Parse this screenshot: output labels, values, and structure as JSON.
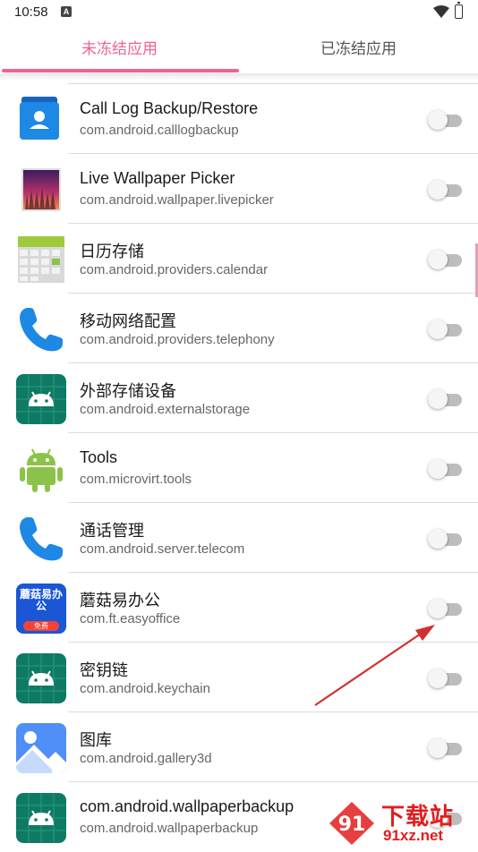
{
  "status_bar": {
    "time": "10:58",
    "notification_glyph": "A"
  },
  "tabs": [
    {
      "label": "未冻结应用",
      "active": true
    },
    {
      "label": "已冻结应用",
      "active": false
    }
  ],
  "colors": {
    "accent": "#f06292",
    "toggle_off": "#bdbdbd",
    "arrow": "#d32f2f"
  },
  "apps": [
    {
      "title": "Call Log Backup/Restore",
      "package": "com.android.calllogbackup",
      "icon": "contacts-backup-icon",
      "enabled": false
    },
    {
      "title": "Live Wallpaper Picker",
      "package": "com.android.wallpaper.livepicker",
      "icon": "wallpaper-picker-icon",
      "enabled": false
    },
    {
      "title": "日历存储",
      "package": "com.android.providers.calendar",
      "icon": "calendar-storage-icon",
      "enabled": false
    },
    {
      "title": "移动网络配置",
      "package": "com.android.providers.telephony",
      "icon": "phone-icon",
      "enabled": false
    },
    {
      "title": "外部存储设备",
      "package": "com.android.externalstorage",
      "icon": "android-icon",
      "enabled": false
    },
    {
      "title": "Tools",
      "package": "com.microvirt.tools",
      "icon": "android-green-icon",
      "enabled": false
    },
    {
      "title": "通话管理",
      "package": "com.android.server.telecom",
      "icon": "phone-icon",
      "enabled": false
    },
    {
      "title": "蘑菇易办公",
      "package": "com.ft.easyoffice",
      "icon": "easyoffice-icon",
      "enabled": false,
      "icon_text": "蘑菇易办公",
      "icon_badge": "免费"
    },
    {
      "title": "密钥链",
      "package": "com.android.keychain",
      "icon": "android-icon",
      "enabled": false
    },
    {
      "title": "图库",
      "package": "com.android.gallery3d",
      "icon": "gallery-icon",
      "enabled": false
    },
    {
      "title": "com.android.wallpaperbackup",
      "package": "com.android.wallpaperbackup",
      "icon": "android-icon",
      "enabled": false
    }
  ],
  "watermark": {
    "text": "下载站",
    "url": "91xz.net",
    "logo_text": "91"
  }
}
